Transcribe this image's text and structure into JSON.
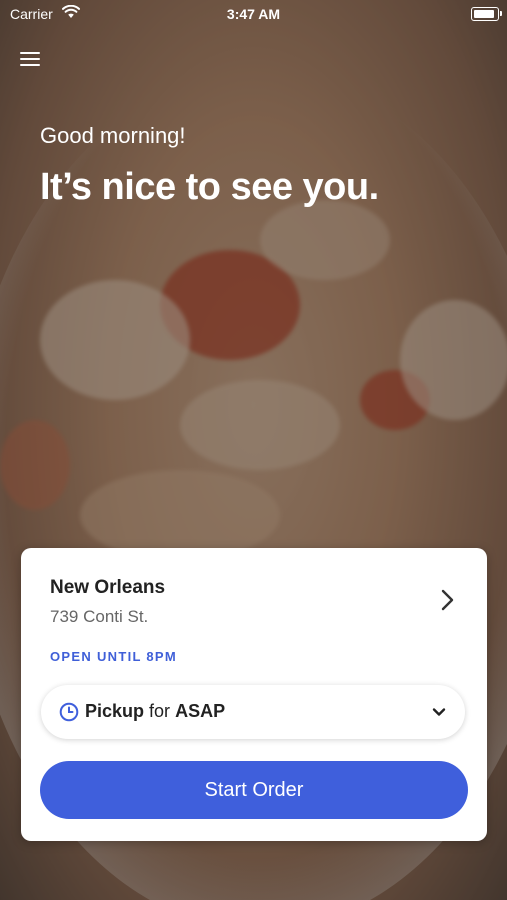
{
  "status_bar": {
    "carrier": "Carrier",
    "time": "3:47 AM"
  },
  "hero": {
    "greeting": "Good morning!",
    "headline": "It’s nice to see you."
  },
  "location": {
    "name": "New Orleans",
    "address": "739 Conti St.",
    "hours": "OPEN UNTIL 8PM"
  },
  "order_mode": {
    "mode": "Pickup",
    "connector": "for",
    "time": "ASAP"
  },
  "actions": {
    "start_order": "Start Order"
  },
  "colors": {
    "accent": "#3f5fdc"
  },
  "icons": [
    "wifi-icon",
    "battery-icon",
    "hamburger-menu-icon",
    "chevron-right-icon",
    "clock-icon",
    "chevron-down-icon"
  ]
}
